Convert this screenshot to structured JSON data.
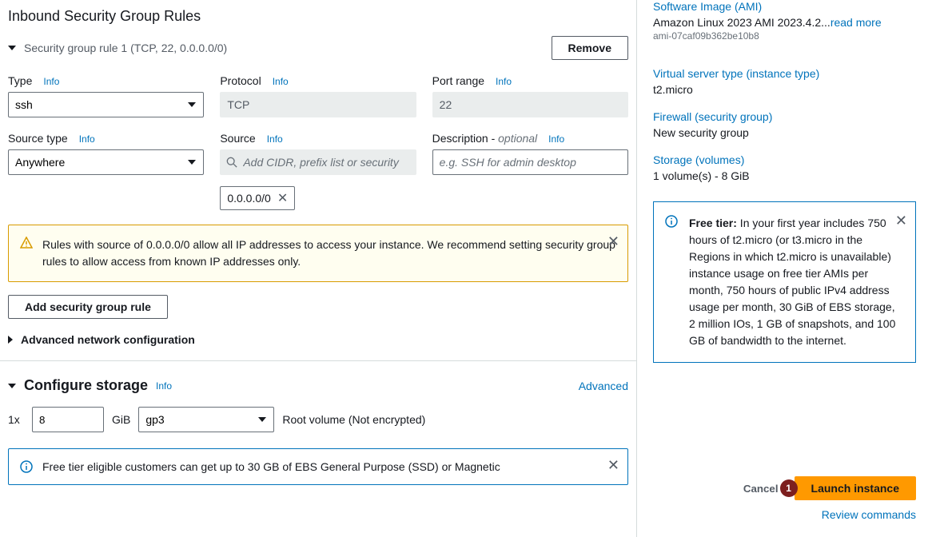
{
  "inbound": {
    "title": "Inbound Security Group Rules",
    "rule_summary": "Security group rule 1 (TCP, 22, 0.0.0.0/0)",
    "remove_label": "Remove",
    "fields": {
      "type_label": "Type",
      "type_value": "ssh",
      "protocol_label": "Protocol",
      "protocol_value": "TCP",
      "port_label": "Port range",
      "port_value": "22",
      "source_type_label": "Source type",
      "source_type_value": "Anywhere",
      "source_label": "Source",
      "source_placeholder": "Add CIDR, prefix list or security",
      "source_chip": "0.0.0.0/0",
      "desc_label": "Description - ",
      "desc_optional": "optional",
      "desc_placeholder": "e.g. SSH for admin desktop",
      "info": "Info"
    },
    "warning": "Rules with source of 0.0.0.0/0 allow all IP addresses to access your instance. We recommend setting security group rules to allow access from known IP addresses only.",
    "add_rule_label": "Add security group rule",
    "adv_net_label": "Advanced network configuration"
  },
  "storage": {
    "title": "Configure storage",
    "info": "Info",
    "advanced": "Advanced",
    "qty": "1x",
    "size": "8",
    "unit": "GiB",
    "vol_type": "gp3",
    "root": "Root volume  (Not encrypted)",
    "free_tier_msg": "Free tier eligible customers can get up to 30 GB of EBS General Purpose (SSD) or Magnetic"
  },
  "summary": {
    "ami_link": "Software Image (AMI)",
    "ami_name": "Amazon Linux 2023 AMI 2023.4.2...",
    "read_more": "read more",
    "ami_id": "ami-07caf09b362be10b8",
    "instance_type_link": "Virtual server type (instance type)",
    "instance_type": "t2.micro",
    "firewall_link": "Firewall (security group)",
    "firewall_val": "New security group",
    "storage_link": "Storage (volumes)",
    "storage_val": "1 volume(s) - 8 GiB",
    "free_tier_label": "Free tier:",
    "free_tier_text": " In your first year includes 750 hours of t2.micro (or t3.micro in the Regions in which t2.micro is unavailable) instance usage on free tier AMIs per month, 750 hours of public IPv4 address usage per month, 30 GiB of EBS storage, 2 million IOs, 1 GB of snapshots, and 100 GB of bandwidth to the internet."
  },
  "actions": {
    "cancel": "Cancel",
    "launch": "Launch instance",
    "badge": "1",
    "review": "Review commands"
  }
}
